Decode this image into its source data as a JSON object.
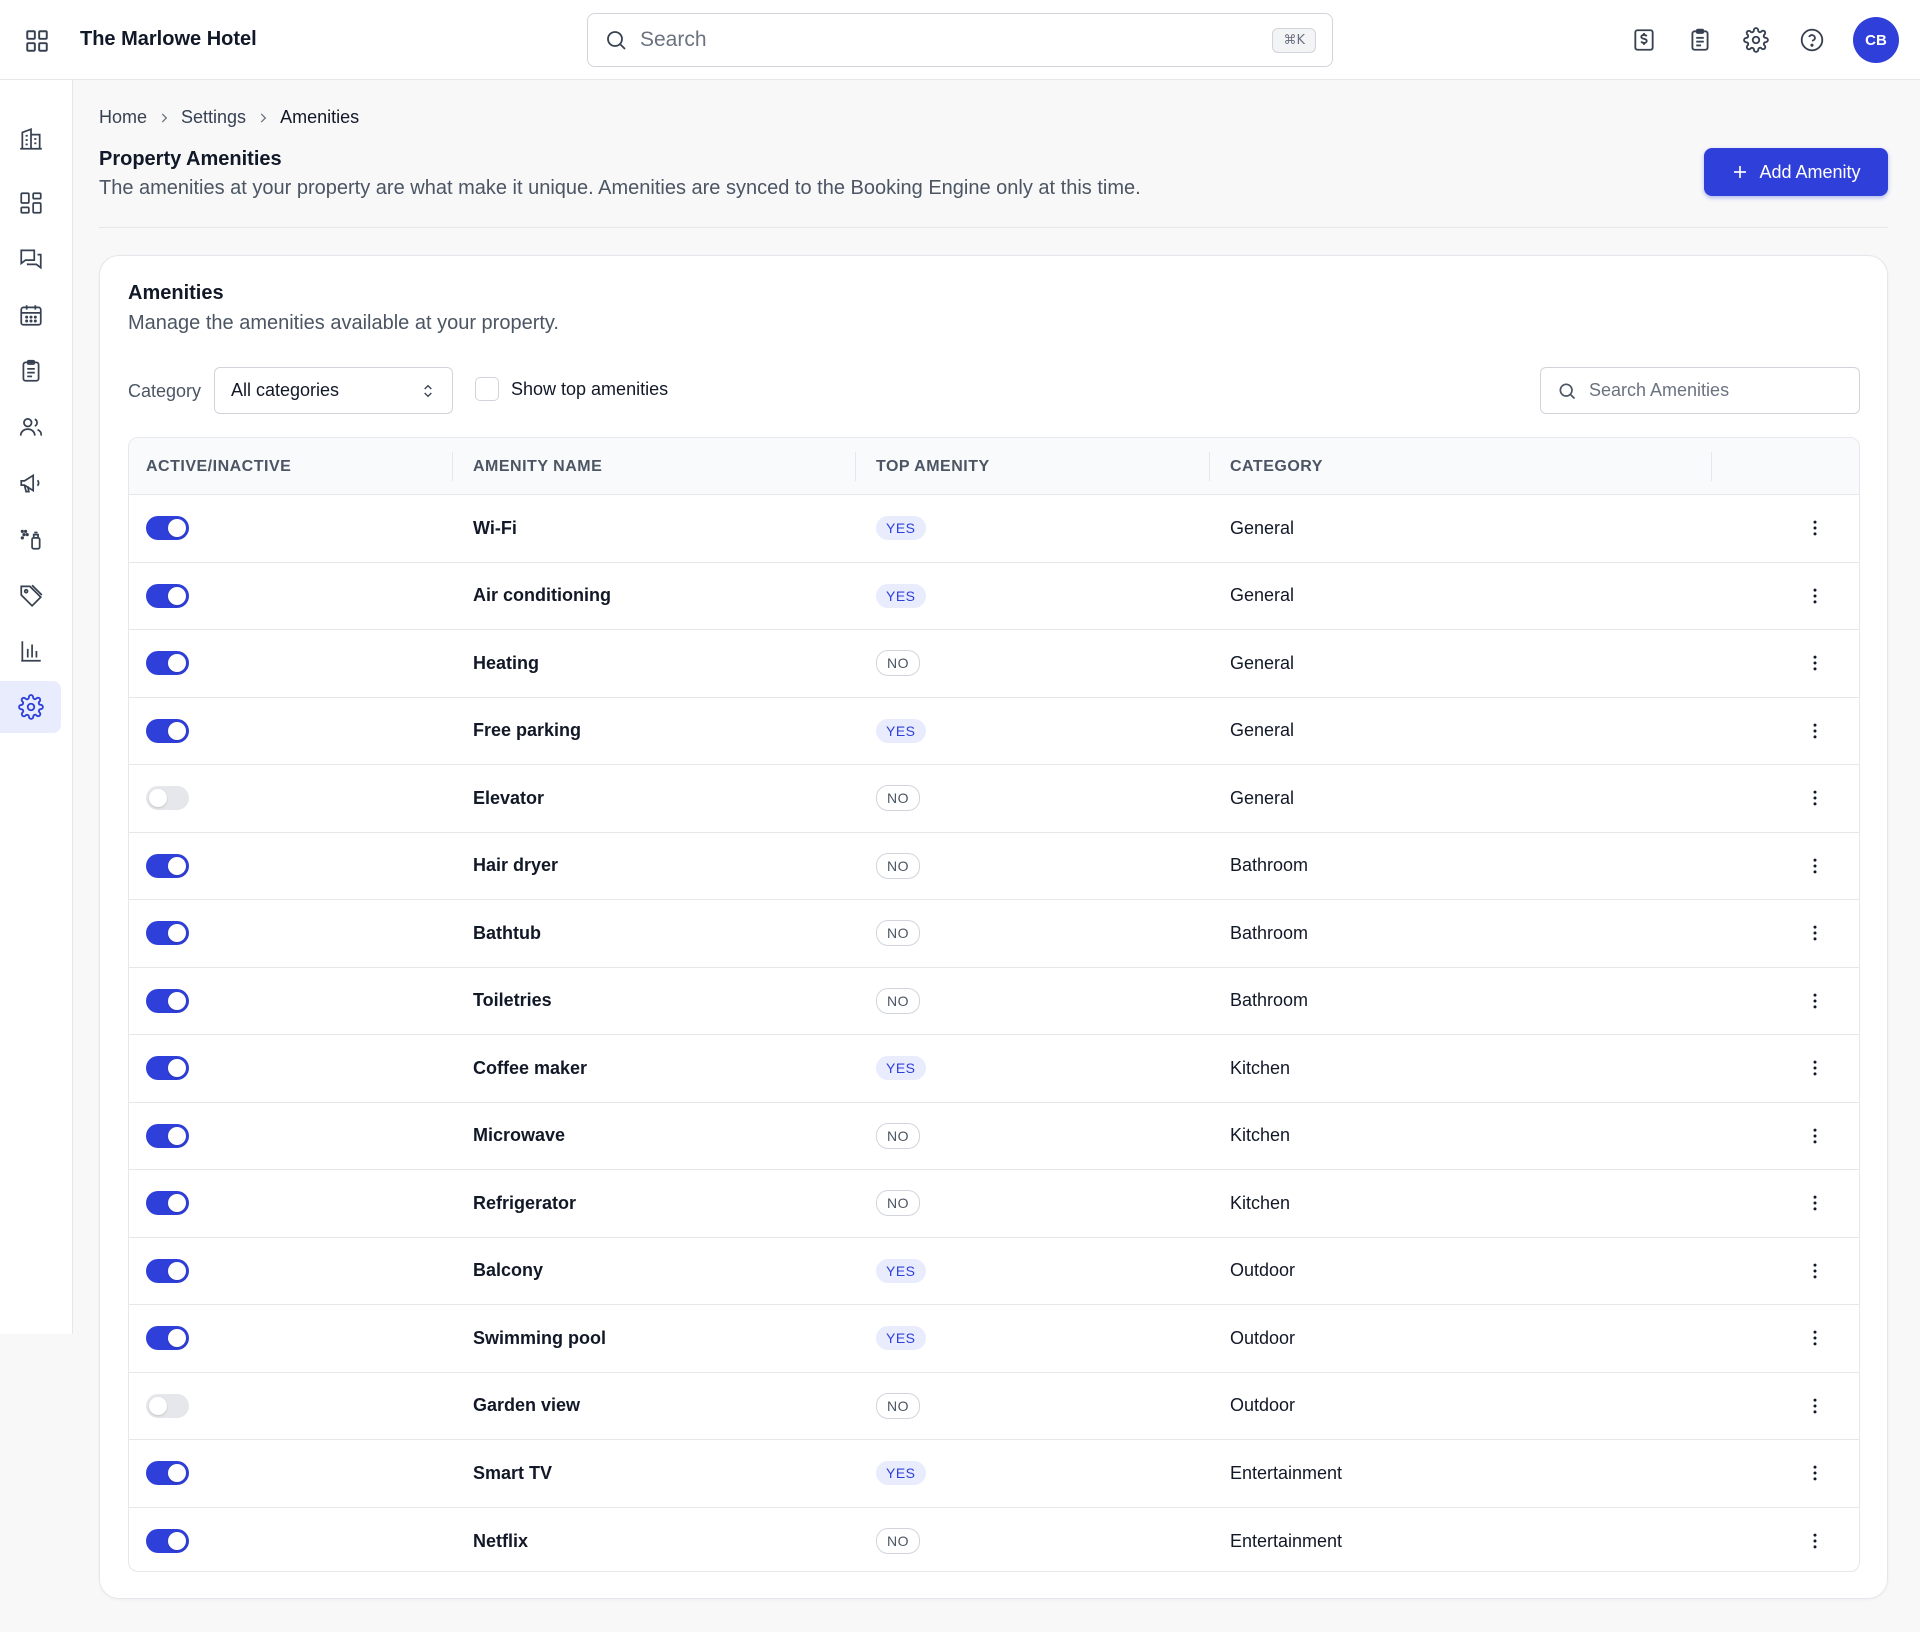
{
  "header": {
    "hotel_name": "The Marlowe Hotel",
    "search_placeholder": "Search",
    "shortcut": "⌘K",
    "avatar_initials": "CB"
  },
  "sidebar": {
    "items": [
      {
        "icon": "building-icon"
      },
      {
        "icon": "dashboard-icon"
      },
      {
        "icon": "messages-icon"
      },
      {
        "icon": "calendar-icon"
      },
      {
        "icon": "clipboard-icon"
      },
      {
        "icon": "guests-icon"
      },
      {
        "icon": "megaphone-icon"
      },
      {
        "icon": "housekeeping-icon"
      },
      {
        "icon": "tag-icon"
      },
      {
        "icon": "reports-icon"
      },
      {
        "icon": "settings-icon",
        "active": true
      }
    ]
  },
  "breadcrumb": [
    "Home",
    "Settings",
    "Amenities"
  ],
  "page": {
    "title": "Property Amenities",
    "description": "The amenities at your property are what make it unique. Amenities are synced to the Booking Engine only at this time.",
    "add_button": "Add Amenity"
  },
  "card": {
    "title": "Amenities",
    "description": "Manage the amenities available at your property.",
    "category_label": "Category",
    "category_value": "All categories",
    "show_top_label": "Show top amenities",
    "search_placeholder": "Search Amenities"
  },
  "table": {
    "columns": [
      "ACTIVE/INACTIVE",
      "AMENITY NAME",
      "TOP AMENITY",
      "CATEGORY"
    ],
    "rows": [
      {
        "active": true,
        "name": "Wi-Fi",
        "top": "YES",
        "category": "General"
      },
      {
        "active": true,
        "name": "Air conditioning",
        "top": "YES",
        "category": "General"
      },
      {
        "active": true,
        "name": "Heating",
        "top": "NO",
        "category": "General"
      },
      {
        "active": true,
        "name": "Free parking",
        "top": "YES",
        "category": "General"
      },
      {
        "active": false,
        "name": "Elevator",
        "top": "NO",
        "category": "General"
      },
      {
        "active": true,
        "name": "Hair dryer",
        "top": "NO",
        "category": "Bathroom"
      },
      {
        "active": true,
        "name": "Bathtub",
        "top": "NO",
        "category": "Bathroom"
      },
      {
        "active": true,
        "name": "Toiletries",
        "top": "NO",
        "category": "Bathroom"
      },
      {
        "active": true,
        "name": "Coffee maker",
        "top": "YES",
        "category": "Kitchen"
      },
      {
        "active": true,
        "name": "Microwave",
        "top": "NO",
        "category": "Kitchen"
      },
      {
        "active": true,
        "name": "Refrigerator",
        "top": "NO",
        "category": "Kitchen"
      },
      {
        "active": true,
        "name": "Balcony",
        "top": "YES",
        "category": "Outdoor"
      },
      {
        "active": true,
        "name": "Swimming pool",
        "top": "YES",
        "category": "Outdoor"
      },
      {
        "active": false,
        "name": "Garden view",
        "top": "NO",
        "category": "Outdoor"
      },
      {
        "active": true,
        "name": "Smart TV",
        "top": "YES",
        "category": "Entertainment"
      },
      {
        "active": true,
        "name": "Netflix",
        "top": "NO",
        "category": "Entertainment"
      }
    ]
  },
  "colors": {
    "accent": "#2f3fd9",
    "accent_light": "#e8ecfd",
    "toggle_off": "#e5e7eb"
  }
}
